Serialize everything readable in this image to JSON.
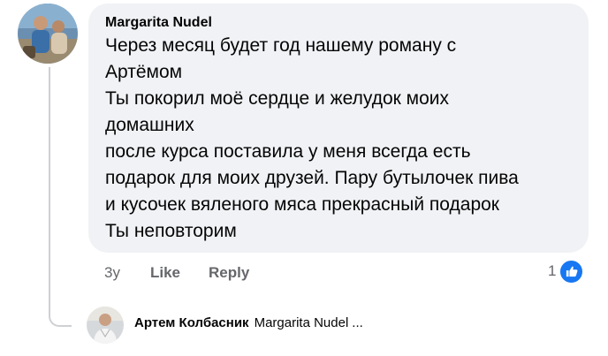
{
  "comment": {
    "author": "Margarita Nudel",
    "lines": [
      "Через месяц будет год нашему роману с",
      "Артёмом",
      "Ты покорил моё сердце и желудок моих",
      "домашних",
      "после курса поставила у меня всегда есть",
      "подарок для моих друзей. Пару бутылочек пива",
      "и кусочек вяленого мяса прекрасный подарок",
      "Ты неповторим"
    ],
    "time": "3y",
    "like_label": "Like",
    "reply_label": "Reply",
    "reaction_count": "1",
    "reaction_icon": "like-icon"
  },
  "reply": {
    "author": "Артем Колбасник",
    "mention": "Margarita Nudel",
    "ellipsis": "..."
  },
  "colors": {
    "bubble": "#f0f2f5",
    "like_blue": "#1877f2",
    "meta_text": "#65676b",
    "thread_line": "#ced0d4"
  }
}
